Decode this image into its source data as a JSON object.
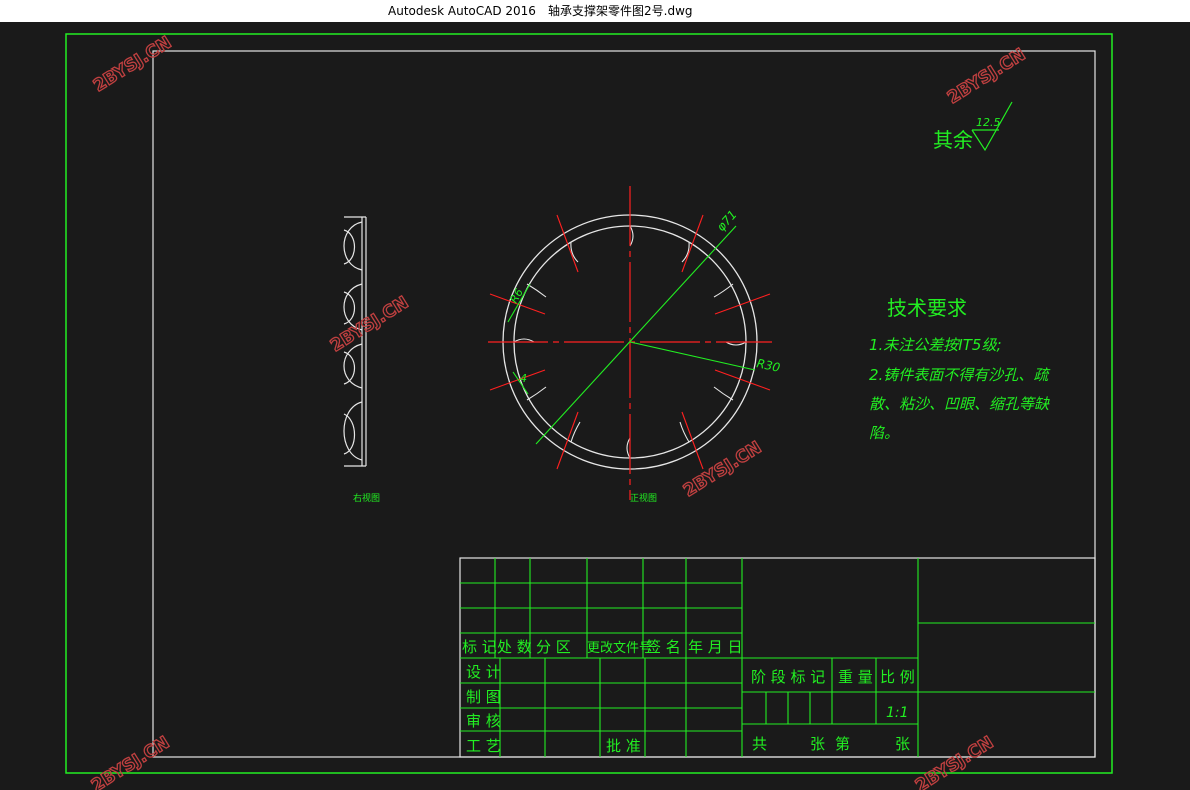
{
  "window": {
    "app": "Autodesk AutoCAD 2016",
    "file": "轴承支撑架零件图2号.dwg"
  },
  "roughness": {
    "label": "其余",
    "value": "12.5"
  },
  "tech_req": {
    "title": "技术要求",
    "lines": [
      "1.未注公差按IT5级;",
      "2.铸件表面不得有沙孔、疏",
      "散、粘沙、凹眼、缩孔等缺",
      "陷。"
    ]
  },
  "views": {
    "side": "右视图",
    "front": "正视图"
  },
  "dims": {
    "d71": "φ71",
    "r6": "R6",
    "r30": "R30",
    "d4": "4"
  },
  "title_block": {
    "rev_headers": [
      "标 记",
      "处 数",
      "分  区",
      "更改文件号",
      "签  名",
      "年 月 日"
    ],
    "roles": [
      "设 计",
      "制 图",
      "审 核",
      "工 艺"
    ],
    "approve": "批 准",
    "stage": "阶 段 标 记",
    "weight": "重 量",
    "ratio": "比 例",
    "scale": "1:1",
    "total": "共",
    "sheets": "张",
    "page": "第",
    "sheet_end": "张"
  },
  "watermark": "2BYSJ.CN",
  "colors": {
    "green": "#22ee22",
    "red": "#ff2020",
    "white": "#e6e6e6",
    "bg": "#1a1a1a"
  }
}
